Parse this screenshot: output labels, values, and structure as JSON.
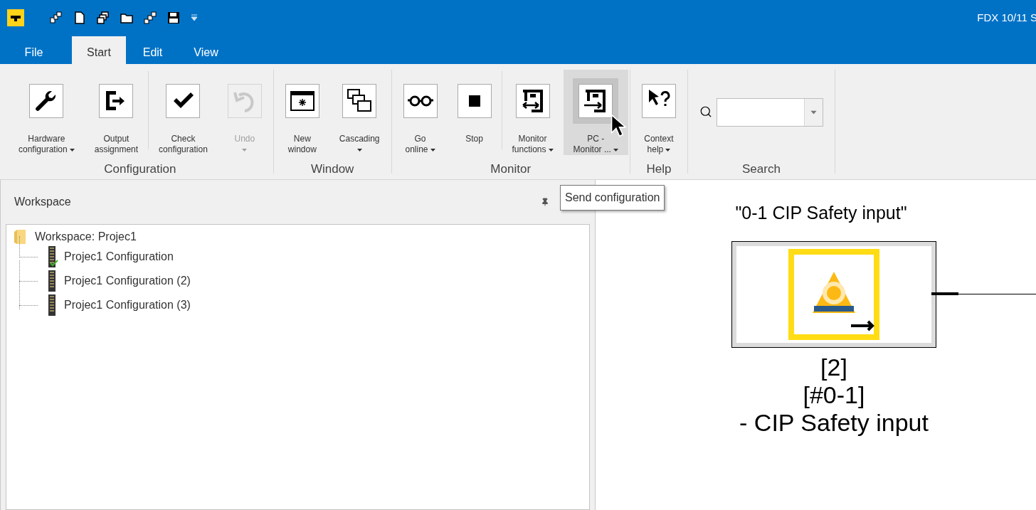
{
  "window": {
    "title": "FDX 10/11 S"
  },
  "quick_access": {
    "dropdown": true
  },
  "tabs": [
    {
      "label": "File",
      "selected": false
    },
    {
      "label": "Start",
      "selected": true
    },
    {
      "label": "Edit",
      "selected": false
    },
    {
      "label": "View",
      "selected": false
    }
  ],
  "ribbon": {
    "groups": [
      {
        "label": "Configuration",
        "items": [
          {
            "kind": "button",
            "lines": [
              "Hardware",
              "configuration"
            ],
            "dropdown": true,
            "disabled": false,
            "hovered": false
          },
          {
            "kind": "button",
            "lines": [
              "Output",
              "assignment"
            ],
            "dropdown": false,
            "disabled": false,
            "hovered": false
          },
          {
            "kind": "separator"
          },
          {
            "kind": "button",
            "lines": [
              "Check",
              "configuration"
            ],
            "dropdown": false,
            "disabled": false,
            "hovered": false
          },
          {
            "kind": "button",
            "lines": [
              "Undo"
            ],
            "dropdown": true,
            "disabled": true,
            "hovered": false
          }
        ]
      },
      {
        "label": "Window",
        "items": [
          {
            "kind": "button",
            "lines": [
              "New",
              "window"
            ],
            "dropdown": false,
            "disabled": false,
            "hovered": false
          },
          {
            "kind": "button",
            "lines": [
              "Cascading"
            ],
            "dropdown": true,
            "disabled": false,
            "hovered": false
          }
        ]
      },
      {
        "label": "Monitor",
        "items": [
          {
            "kind": "button",
            "lines": [
              "Go",
              "online"
            ],
            "dropdown": true,
            "disabled": false,
            "hovered": false
          },
          {
            "kind": "button",
            "lines": [
              "Stop"
            ],
            "dropdown": false,
            "disabled": false,
            "hovered": false
          },
          {
            "kind": "separator"
          },
          {
            "kind": "button",
            "lines": [
              "Monitor",
              "functions"
            ],
            "dropdown": true,
            "disabled": false,
            "hovered": false
          },
          {
            "kind": "button",
            "lines": [
              "PC -",
              "Monitor ..."
            ],
            "dropdown": true,
            "disabled": false,
            "hovered": true
          }
        ]
      },
      {
        "label": "Help",
        "items": [
          {
            "kind": "button",
            "lines": [
              "Context",
              "help"
            ],
            "dropdown": true,
            "disabled": false,
            "hovered": false
          }
        ]
      },
      {
        "label": "Search",
        "items": [
          {
            "kind": "search",
            "value": ""
          }
        ]
      }
    ]
  },
  "tooltip": {
    "text": "Send configuration"
  },
  "workspace": {
    "title": "Workspace",
    "tree": {
      "label": "Workspace: Projec1",
      "children": [
        {
          "label": "Projec1 Configuration",
          "valid": true
        },
        {
          "label": "Projec1 Configuration (2)",
          "valid": false
        },
        {
          "label": "Projec1 Configuration (3)",
          "valid": false
        }
      ]
    }
  },
  "canvas": {
    "module": {
      "title": "\"0-1 CIP Safety input\"",
      "lines": [
        "[2]",
        "[#0-1]",
        "- CIP Safety input"
      ]
    }
  }
}
